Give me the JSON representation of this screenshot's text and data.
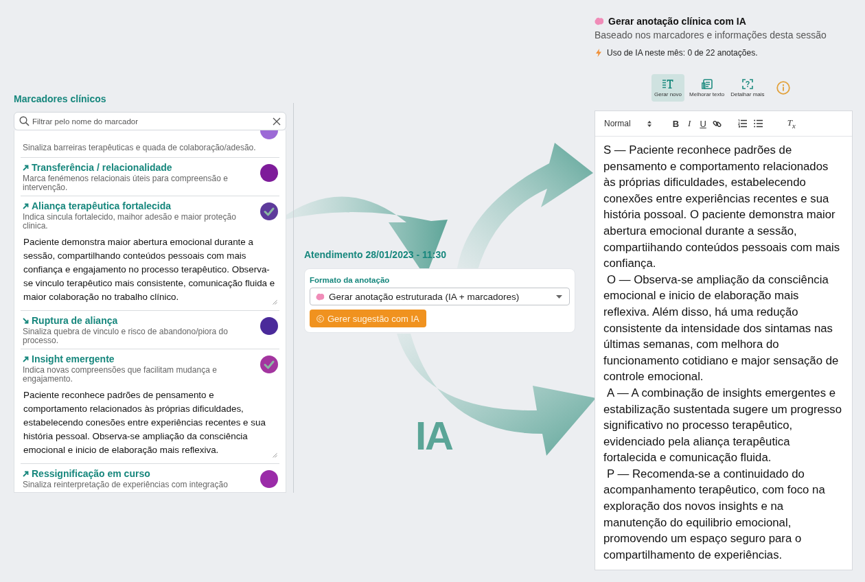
{
  "markers_panel": {
    "title": "Marcadores clínicos",
    "search": {
      "placeholder": "Filtrar pelo nome do marcador"
    },
    "items": [
      {
        "description": "Sinaliza barreiras terapêuticas e quada de colaboração/adesão.",
        "color": "#9c6ad6",
        "checked": false
      },
      {
        "kind": "rising",
        "title": "Transferência / relacionalidade",
        "description": "Marca fenémenos relacionais úteis para compreensão e intervenção.",
        "color": "#7e1c9a",
        "checked": false
      },
      {
        "kind": "rising",
        "title": "Aliança terapêutica fortalecida",
        "description": "Indica sincula fortalecido, maihor adesão e maior proteção clinica.",
        "color": "#5d3a9b",
        "checked": true,
        "note": "Paciente demonstra maior abertura emocional durante a sessão, compartilhando conteúdos pessoais com mais confiança e engajamento no processo terapêutico. Observa-se vinculo terapêutico mais consistente, comunicação fluida e maior colaboração no trabalho clínico."
      },
      {
        "kind": "falling",
        "title": "Ruptura de aliança",
        "description": "Sinaliza quebra de vinculo e risco de abandono/piora do processo.",
        "color": "#4a2a9a",
        "checked": false
      },
      {
        "kind": "rising",
        "title": "Insight emergente",
        "description": "Indica novas compreensões que facilitam mudança e engajamento.",
        "color": "#a3359f",
        "checked": true,
        "note": "Paciente reconhece padrões de pensamento e comportamento relacionados às próprias dificuldades, estabelecendo conesões entre experiências recentes e sua história pessoal. Observa-se ampliação da consciência emocional e inicio de elaboração mais reflexiva."
      },
      {
        "kind": "rising",
        "title": "Ressignificação em curso",
        "description": "Sinaliza reinterpretação de experiências com integração",
        "color": "#9a2ba8",
        "checked": false
      }
    ]
  },
  "session": {
    "title": "Atendimento 28/01/2023 - 11:30",
    "format_label": "Formato da anotação",
    "format_select": {
      "value": "Gerar anotação estruturada (IA + marcadores)"
    },
    "generate_button": "Gerer sugestão com IA"
  },
  "logo_text": "IA",
  "ai_panel": {
    "title": "Gerar anotação clínica com IA",
    "subtitle": "Baseado nos marcadores e informações desta sessão",
    "usage": "Uso de IA neste mês: 0 de 22 anotações.",
    "actions": [
      {
        "kind": "generate",
        "label": "Gerar novo",
        "selected": true
      },
      {
        "kind": "improve",
        "label": "Melhorar texto",
        "selected": false
      },
      {
        "kind": "detail",
        "label": "Detalhar mais",
        "selected": false
      }
    ],
    "editor": {
      "style_select": "Normal",
      "format_buttons": [
        {
          "kind": "bold",
          "label": "B"
        },
        {
          "kind": "italic",
          "label": "I"
        },
        {
          "kind": "underline",
          "label": "U"
        }
      ],
      "clear_button": "T$_{x}$",
      "paragraphs": [
        "S — Paciente reconhece padrões de pensamento e comportamento relacionados às próprias dificuldades, estabelecendo conexões entre experiências recentes e sua história possoal. O paciente demonstra maior abertura emocional durante a sessão, compartiihando conteúdos pessoais com mais confiança.",
        "O — Observa-se ampliação da consciência emocional e inicio de elaboração mais reflexiva. Além disso, há uma redução consistente da intensidade dos sintamas nas últimas semanas, com melhora do funcionamento cotidiano e major sensação de controle emocional.",
        "A — A combinação de insights emergentes e estabilização sustentada sugere um progresso significativo no processo terapêutico, evidenciado pela aliança terapêutica fortalecida e comunicação fluida.",
        "P — Recomenda-se a continuidado do acompanhamento terapêutico, com foco na exploração dos novos insights e na manutenção do equilibrio emocional, promovendo um espaço seguro para o compartilhamento de experiências."
      ]
    }
  }
}
